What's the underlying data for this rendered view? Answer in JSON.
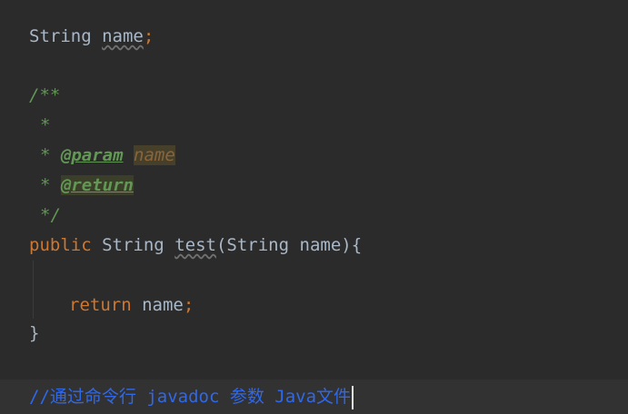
{
  "editor": {
    "line1": {
      "type": "String",
      "name": "name",
      "semi": ";"
    },
    "doc": {
      "open": "/**",
      "star": "*",
      "param_tag": "@param",
      "param_name": "name",
      "return_tag": "@return",
      "close": "*/"
    },
    "method": {
      "modifier": "public",
      "ret_type": "String",
      "name": "test",
      "open_paren": "(",
      "param_type": "String",
      "param_name": "name",
      "close_paren": ")",
      "open_brace": "{"
    },
    "body": {
      "keyword": "return",
      "value": "name",
      "semi": ";"
    },
    "close_brace": "}",
    "comment": "//通过命令行 javadoc 参数 Java文件"
  },
  "colors": {
    "background": "#2b2b2b",
    "keyword": "#cc7832",
    "text": "#a9b7c6",
    "doc_comment": "#629755",
    "line_comment": "#3068e8"
  }
}
